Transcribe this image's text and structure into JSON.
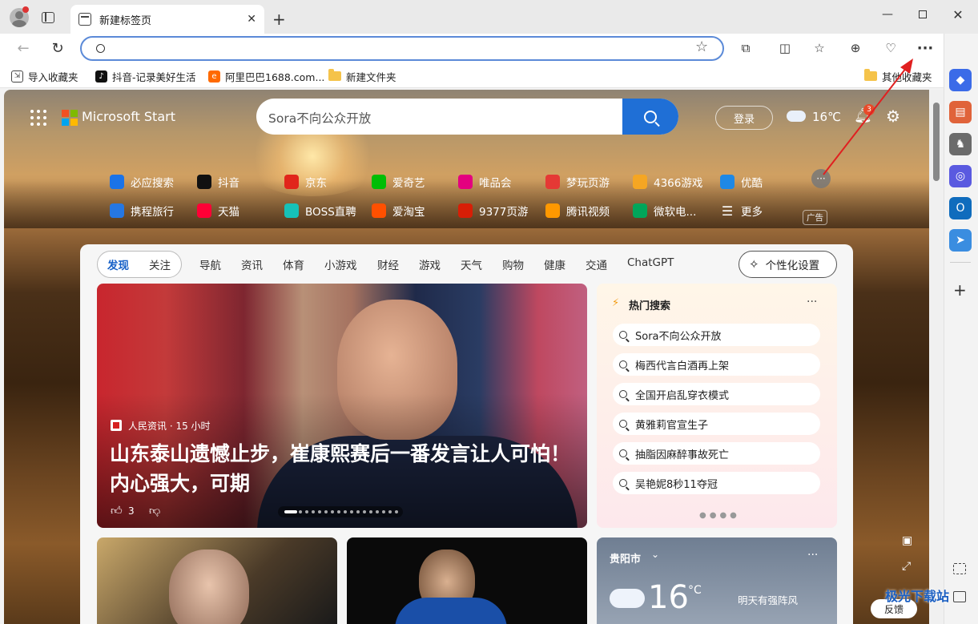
{
  "tab": {
    "title": "新建标签页"
  },
  "favorites": [
    {
      "label": "导入收藏夹"
    },
    {
      "label": "抖音-记录美好生活"
    },
    {
      "label": "阿里巴巴1688.com..."
    },
    {
      "label": "新建文件夹"
    },
    {
      "label": "其他收藏夹"
    }
  ],
  "start": {
    "brand": "Microsoft Start",
    "search_placeholder": "Sora不向公众开放",
    "login": "登录",
    "temp": "16℃",
    "notif_count": "3",
    "ad": "广告"
  },
  "quicklinks": [
    {
      "label": "必应搜索",
      "color": "#1a73e8"
    },
    {
      "label": "抖音",
      "color": "#111111"
    },
    {
      "label": "京东",
      "color": "#e1251b"
    },
    {
      "label": "爱奇艺",
      "color": "#00be06"
    },
    {
      "label": "唯品会",
      "color": "#e4007f"
    },
    {
      "label": "梦玩页游",
      "color": "#e53935"
    },
    {
      "label": "4366游戏",
      "color": "#f5a623"
    },
    {
      "label": "优酷",
      "color": "#1e88e5"
    },
    {
      "label": "携程旅行",
      "color": "#2577e3"
    },
    {
      "label": "天猫",
      "color": "#ff0036"
    },
    {
      "label": "BOSS直聘",
      "color": "#16c1b8"
    },
    {
      "label": "爱淘宝",
      "color": "#ff5000"
    },
    {
      "label": "9377页游",
      "color": "#d81e06"
    },
    {
      "label": "腾讯视频",
      "color": "#ff9800"
    },
    {
      "label": "微软电...",
      "color": "#00a65a"
    },
    {
      "label": "更多",
      "color": "transparent"
    }
  ],
  "feed_nav": {
    "discover": "发现",
    "follow": "关注",
    "items": [
      "导航",
      "资讯",
      "体育",
      "小游戏",
      "财经",
      "游戏",
      "天气",
      "购物",
      "健康",
      "交通",
      "ChatGPT"
    ],
    "personalize": "个性化设置"
  },
  "hero": {
    "source": "人民资讯 · 15 小时",
    "headline": "山东泰山遗憾止步，崔康熙赛后一番发言让人可怕！内心强大，可期",
    "likes": "3"
  },
  "hot": {
    "title": "热门搜索",
    "items": [
      "Sora不向公众开放",
      "梅西代言白酒再上架",
      "全国开启乱穿衣模式",
      "黄雅莉官宣生子",
      "抽脂因麻醉事故死亡",
      "吴艳妮8秒11夺冠"
    ]
  },
  "weather": {
    "city": "贵阳市",
    "temp": "16",
    "unit": "°C",
    "forecast": "明天有强阵风"
  },
  "feedback": "反馈",
  "watermark": "极光下载站"
}
